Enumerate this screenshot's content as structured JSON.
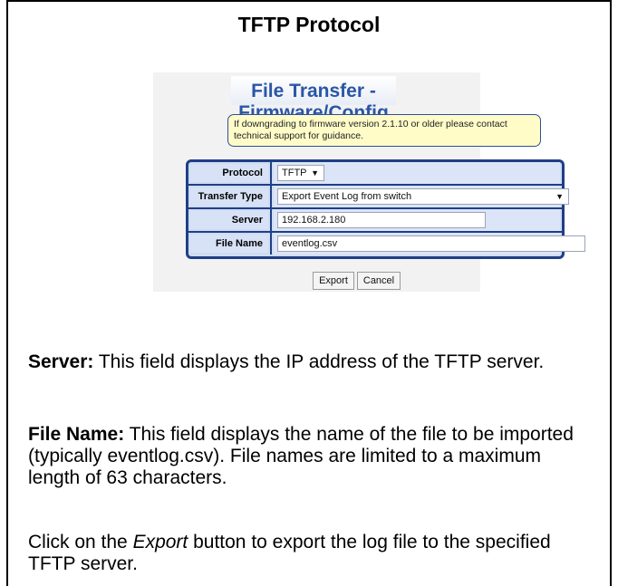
{
  "doc": {
    "title": "TFTP Protocol"
  },
  "panel": {
    "title": "File Transfer - Firmware/Config",
    "notice": "If downgrading to firmware version 2.1.10 or older please contact technical support for guidance.",
    "fields": [
      {
        "label": "Protocol",
        "value": "TFTP",
        "kind": "select"
      },
      {
        "label": "Transfer Type",
        "value": "Export Event Log from switch",
        "kind": "select"
      },
      {
        "label": "Server",
        "value": "192.168.2.180",
        "kind": "text"
      },
      {
        "label": "File Name",
        "value": "eventlog.csv",
        "kind": "text"
      }
    ],
    "buttons": {
      "export": "Export",
      "cancel": "Cancel"
    },
    "icons": {
      "dropdown": "chevron-down-icon"
    }
  },
  "paragraphs": {
    "server_term": "Server:",
    "server_text": " This field displays the IP address of the TFTP server.",
    "filename_term": "File Name:",
    "filename_text": " This field displays the name of the file to be imported (typically eventlog.csv). File names are limited to a maximum length of 63 characters.",
    "click_pre": "Click on the ",
    "click_em": "Export",
    "click_post": " button to export the log file to the specified TFTP server."
  },
  "colors": {
    "panel_title": "#2a56a6",
    "form_border": "#1f3f86",
    "notice_bg": "#fffcc8"
  }
}
